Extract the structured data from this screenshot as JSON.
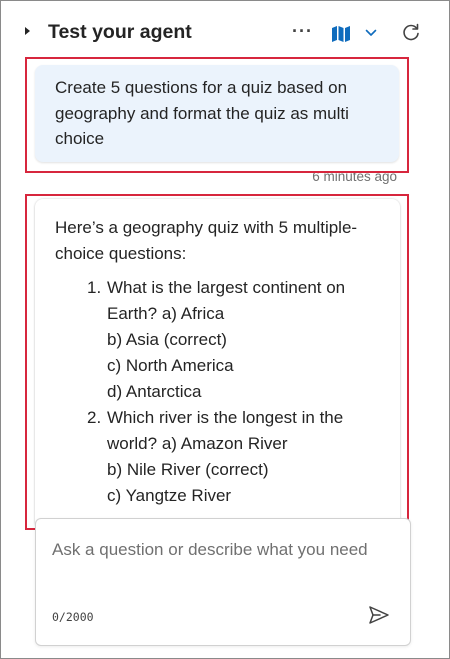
{
  "header": {
    "title": "Test your agent",
    "more_label": "···",
    "icons": [
      "collapse-caret-icon",
      "more-options-icon",
      "map-icon",
      "chevron-down-icon",
      "refresh-icon"
    ]
  },
  "conversation": {
    "user_message": "Create 5 questions for a quiz based on geography and format the quiz as multi choice",
    "user_timestamp": "6 minutes ago",
    "bot_intro": "Here’s a geography quiz with 5 multiple-choice questions:",
    "questions": [
      {
        "number": "1.",
        "text": "What is the largest continent on Earth?",
        "options": [
          "a) Africa",
          "b) Asia (correct)",
          "c) North America",
          "d) Antarctica"
        ]
      },
      {
        "number": "2.",
        "text": "Which river is the longest in the world?",
        "options": [
          "a) Amazon River",
          "b) Nile River (correct)",
          "c) Yangtze River"
        ]
      }
    ]
  },
  "composer": {
    "placeholder": "Ask a question or describe what you need",
    "char_count": "0/2000"
  },
  "colors": {
    "accent": "#0f6cbd",
    "user_bubble": "#ebf3fc",
    "highlight": "#d7263d",
    "muted_text": "#707070"
  }
}
